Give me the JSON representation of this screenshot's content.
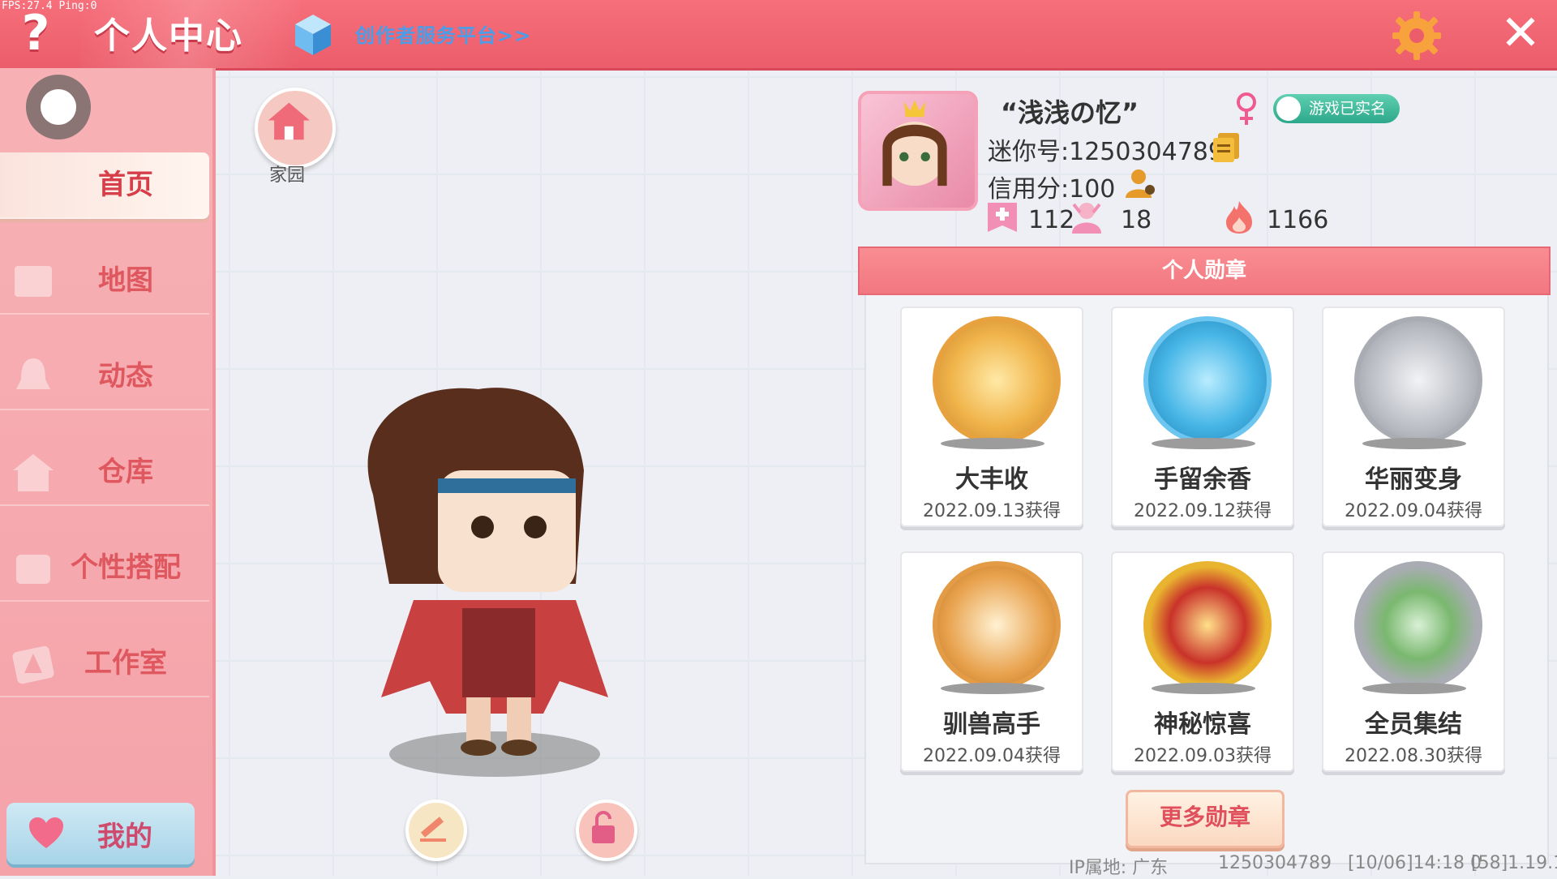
{
  "fps_overlay": "FPS:27.4  Ping:0",
  "header": {
    "help_label": "?",
    "title": "个人中心",
    "creator_link": "创作者服务平台>>",
    "close_label": "✕"
  },
  "sidebar": {
    "items": [
      {
        "label": "首页",
        "icon": "home-icon",
        "active": true
      },
      {
        "label": "地图",
        "icon": "map-icon"
      },
      {
        "label": "动态",
        "icon": "bell-icon"
      },
      {
        "label": "仓库",
        "icon": "house-icon"
      },
      {
        "label": "个性搭配",
        "icon": "outfit-icon"
      },
      {
        "label": "工作室",
        "icon": "tree-icon"
      }
    ],
    "mine_label": "我的"
  },
  "home": {
    "label": "家园"
  },
  "profile": {
    "nickname": "“浅浅の忆”",
    "realname_badge": "游戏已实名",
    "mini_id": "迷你号:1250304789",
    "credit": "信用分:100",
    "stats": {
      "likes": "112",
      "fans": "18",
      "heat": "1166"
    }
  },
  "medals": {
    "title": "个人勋章",
    "items": [
      {
        "name": "大丰收",
        "date": "2022.09.13获得",
        "color": "#f0b44a"
      },
      {
        "name": "手留余香",
        "date": "2022.09.12获得",
        "color": "#47b6e6"
      },
      {
        "name": "华丽变身",
        "date": "2022.09.04获得",
        "color": "#b9bcc3"
      },
      {
        "name": "驯兽高手",
        "date": "2022.09.04获得",
        "color": "#e8a14c"
      },
      {
        "name": "神秘惊喜",
        "date": "2022.09.03获得",
        "color": "#e9b530"
      },
      {
        "name": "全员集结",
        "date": "2022.08.30获得",
        "color": "#a9acb2"
      }
    ],
    "more_label": "更多勋章"
  },
  "footer": {
    "ip": "IP属地: 广东",
    "uid": "1250304789",
    "time": "[10/06]14:18 0",
    "version": "[58]1.19.1"
  },
  "colors": {
    "accent": "#ec5d6b",
    "sidebar": "#f4a3a9",
    "link": "#4a9de8"
  }
}
